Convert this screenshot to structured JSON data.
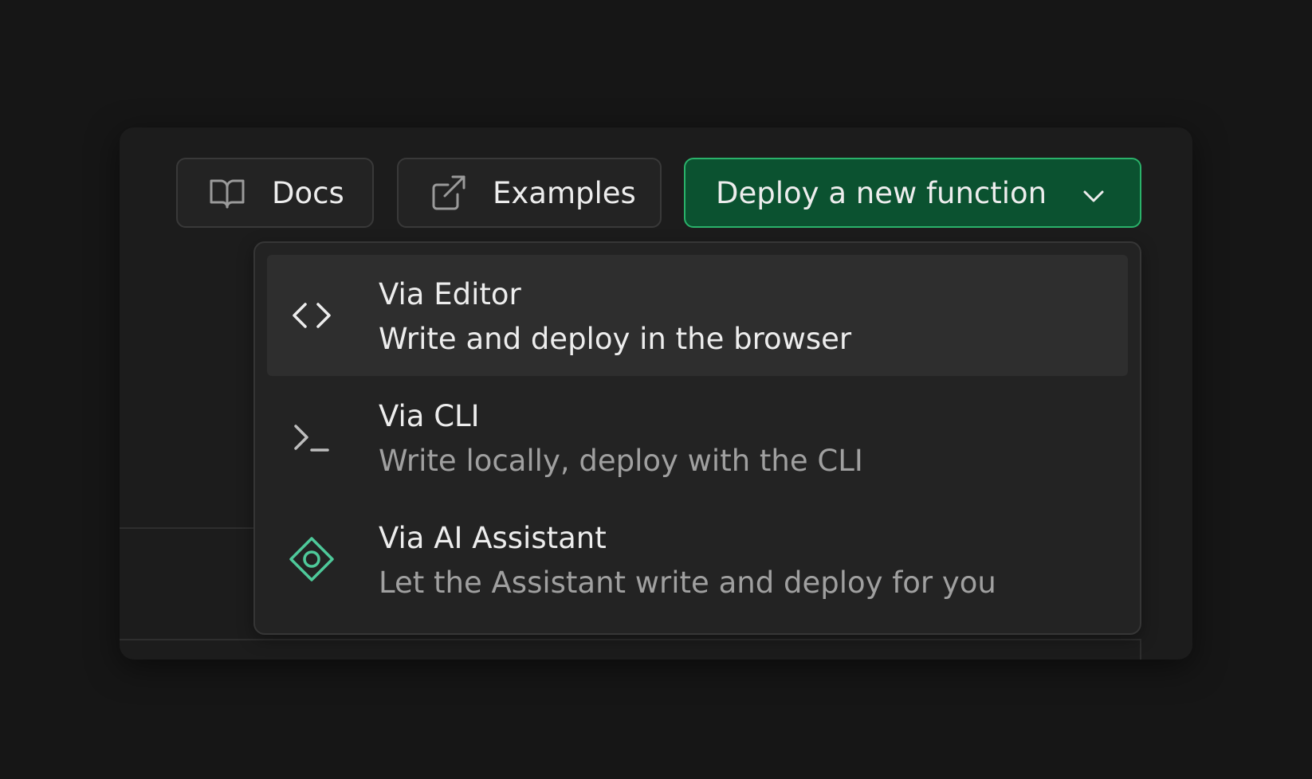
{
  "toolbar": {
    "docs_label": "Docs",
    "examples_label": "Examples",
    "deploy_label": "Deploy a new function"
  },
  "deploy_menu": {
    "items": [
      {
        "title": "Via Editor",
        "description": "Write and deploy in the browser",
        "icon": "code-brackets-icon",
        "active": true
      },
      {
        "title": "Via CLI",
        "description": "Write locally, deploy with the CLI",
        "icon": "terminal-icon",
        "active": false
      },
      {
        "title": "Via AI Assistant",
        "description": "Let the Assistant write and deploy for you",
        "icon": "ai-assistant-icon",
        "active": false
      }
    ]
  },
  "colors": {
    "background": "#161616",
    "panel": "#1c1c1c",
    "primary_fill": "#0b5230",
    "primary_border": "#2ab26a",
    "assistant_icon": "#4ec99a",
    "text": "#ededed",
    "muted_text": "#a0a0a0"
  }
}
